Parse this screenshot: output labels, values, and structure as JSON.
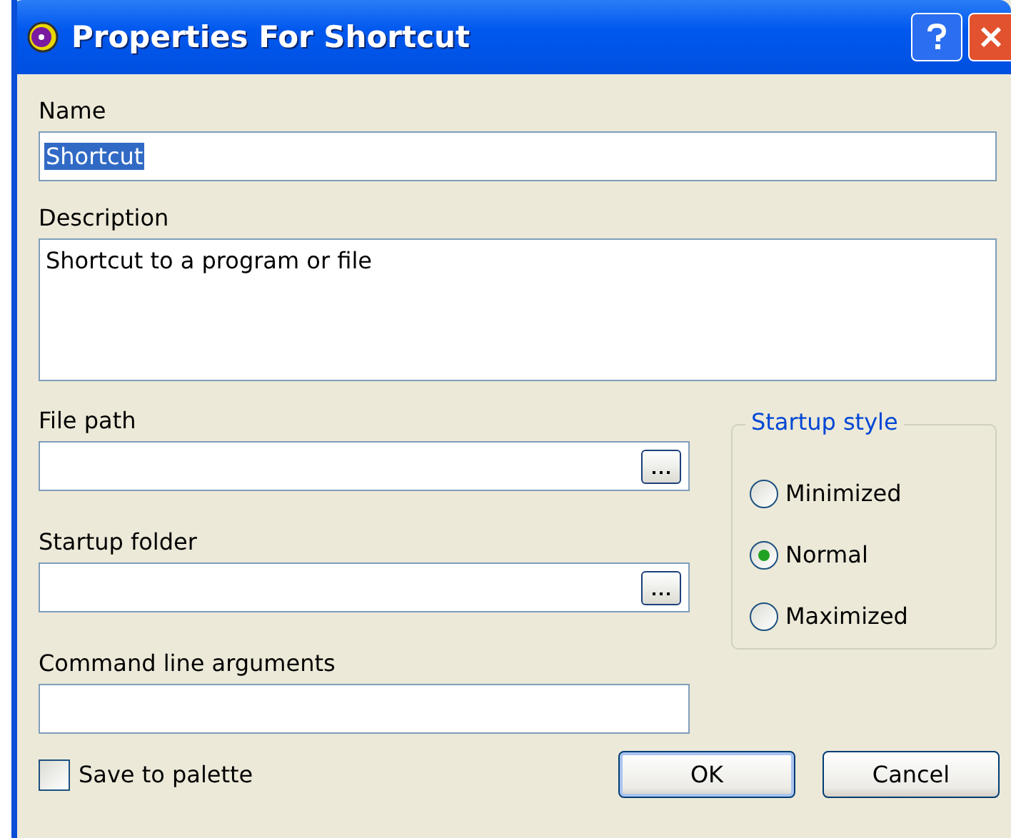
{
  "window": {
    "title": "Properties For Shortcut"
  },
  "name_field": {
    "label": "Name",
    "value": "Shortcut",
    "selected": true
  },
  "description_field": {
    "label": "Description",
    "value": "Shortcut to a program or file"
  },
  "file_path_field": {
    "label": "File path"
  },
  "startup_folder_field": {
    "label": "Startup folder"
  },
  "command_line_field": {
    "label": "Command line arguments"
  },
  "startup_style": {
    "title": "Startup style",
    "options": [
      {
        "label": "Minimized",
        "selected": false
      },
      {
        "label": "Normal",
        "selected": true
      },
      {
        "label": "Maximized",
        "selected": false
      }
    ]
  },
  "save_to_palette": {
    "label": "Save to palette",
    "checked": false
  },
  "buttons": [
    "OK",
    "Cancel"
  ]
}
